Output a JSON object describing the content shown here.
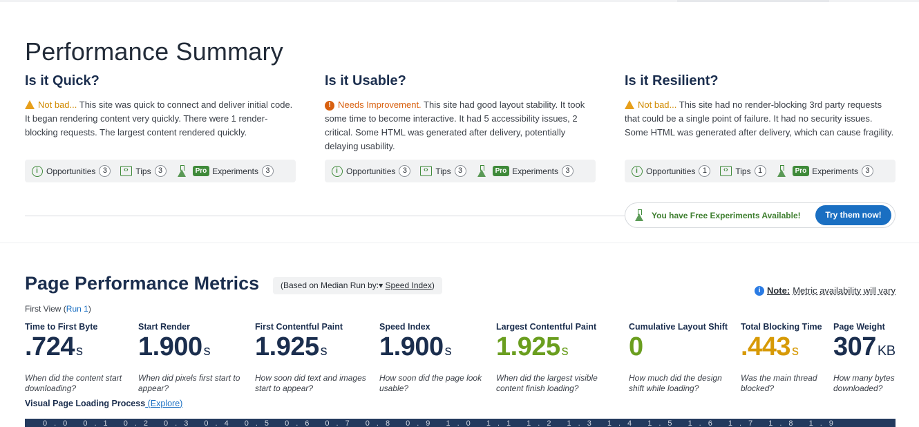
{
  "summary": {
    "title": "Performance Summary",
    "columns": [
      {
        "heading": "Is it Quick?",
        "status": "Not bad...",
        "text": " This site was quick to connect and deliver initial code. It began rendering content very quickly. There were 1 render-blocking requests. The largest content rendered quickly.",
        "opportunities_label": "Opportunities",
        "opportunities_count": "3",
        "tips_label": "Tips",
        "tips_count": "3",
        "pro_label": "Pro",
        "experiments_label": "Experiments",
        "experiments_count": "3"
      },
      {
        "heading": "Is it Usable?",
        "status": "Needs Improvement.",
        "text": " This site had good layout stability. It took some time to become interactive. It had 5 accessibility issues, 2 critical. Some HTML was generated after delivery, potentially delaying usability.",
        "opportunities_label": "Opportunities",
        "opportunities_count": "3",
        "tips_label": "Tips",
        "tips_count": "3",
        "pro_label": "Pro",
        "experiments_label": "Experiments",
        "experiments_count": "3"
      },
      {
        "heading": "Is it Resilient?",
        "status": "Not bad...",
        "text": " This site had no render-blocking 3rd party requests that could be a single point of failure. It had no security issues. Some HTML was generated after delivery, which can cause fragility.",
        "opportunities_label": "Opportunities",
        "opportunities_count": "1",
        "tips_label": "Tips",
        "tips_count": "1",
        "pro_label": "Pro",
        "experiments_label": "Experiments",
        "experiments_count": "3"
      }
    ],
    "promo": {
      "text": "You have Free Experiments Available!",
      "button": "Try them now!"
    }
  },
  "metrics": {
    "title": "Page Performance Metrics",
    "median_prefix": "(Based on Median Run by:▾ ",
    "median_link": "Speed Index",
    "median_suffix": ")",
    "note_label": "Note:",
    "note_text": "Metric availability will vary",
    "first_view": "First View (",
    "run_link": "Run 1",
    "first_view_close": ")",
    "items": [
      {
        "label": "Time to First Byte",
        "value": ".724",
        "unit": "s",
        "question": "When did the content start downloading?"
      },
      {
        "label": "Start Render",
        "value": "1.900",
        "unit": "s",
        "question": "When did pixels first start to appear?"
      },
      {
        "label": "First Contentful Paint",
        "value": "1.925",
        "unit": "s",
        "question": "How soon did text and images start to appear?"
      },
      {
        "label": "Speed Index",
        "value": "1.900",
        "unit": "s",
        "question": "How soon did the page look usable?"
      },
      {
        "label": "Largest Contentful Paint",
        "value": "1.925",
        "unit": "s",
        "question": "When did the largest visible content finish loading?"
      },
      {
        "label": "Cumulative Layout Shift",
        "value": "0",
        "unit": "",
        "question": "How much did the design shift while loading?"
      },
      {
        "label": "Total Blocking Time",
        "value": ".443",
        "unit": "s",
        "question": "Was the main thread blocked?"
      },
      {
        "label": "Page Weight",
        "value": "307",
        "unit": "KB",
        "question": "How many bytes downloaded?"
      }
    ],
    "visual_title": "Visual Page Loading Process",
    "explore_open": " (",
    "explore_link": "Explore",
    "explore_close": ")",
    "filmstrip_text": "0.0  0.1  0.2  0.3  0.4  0.5  0.6  0.7  0.8  0.9  1.0  1.1  1.2  1.3  1.4  1.5  1.6  1.7  1.8  1.9"
  },
  "colors": {
    "heading_navy": "#1b2e4e",
    "warn_amber": "#d08a00",
    "needs_orange": "#d8600f",
    "good_green": "#6a9e1f",
    "tbt_amber": "#d79a06",
    "link_blue": "#1a6fc2"
  },
  "icons": {
    "warning": "warning-triangle-icon",
    "error": "exclamation-circle-icon",
    "opportunities": "info-circle-icon",
    "tips": "code-box-icon",
    "experiments": "flask-icon",
    "note": "info-icon"
  }
}
